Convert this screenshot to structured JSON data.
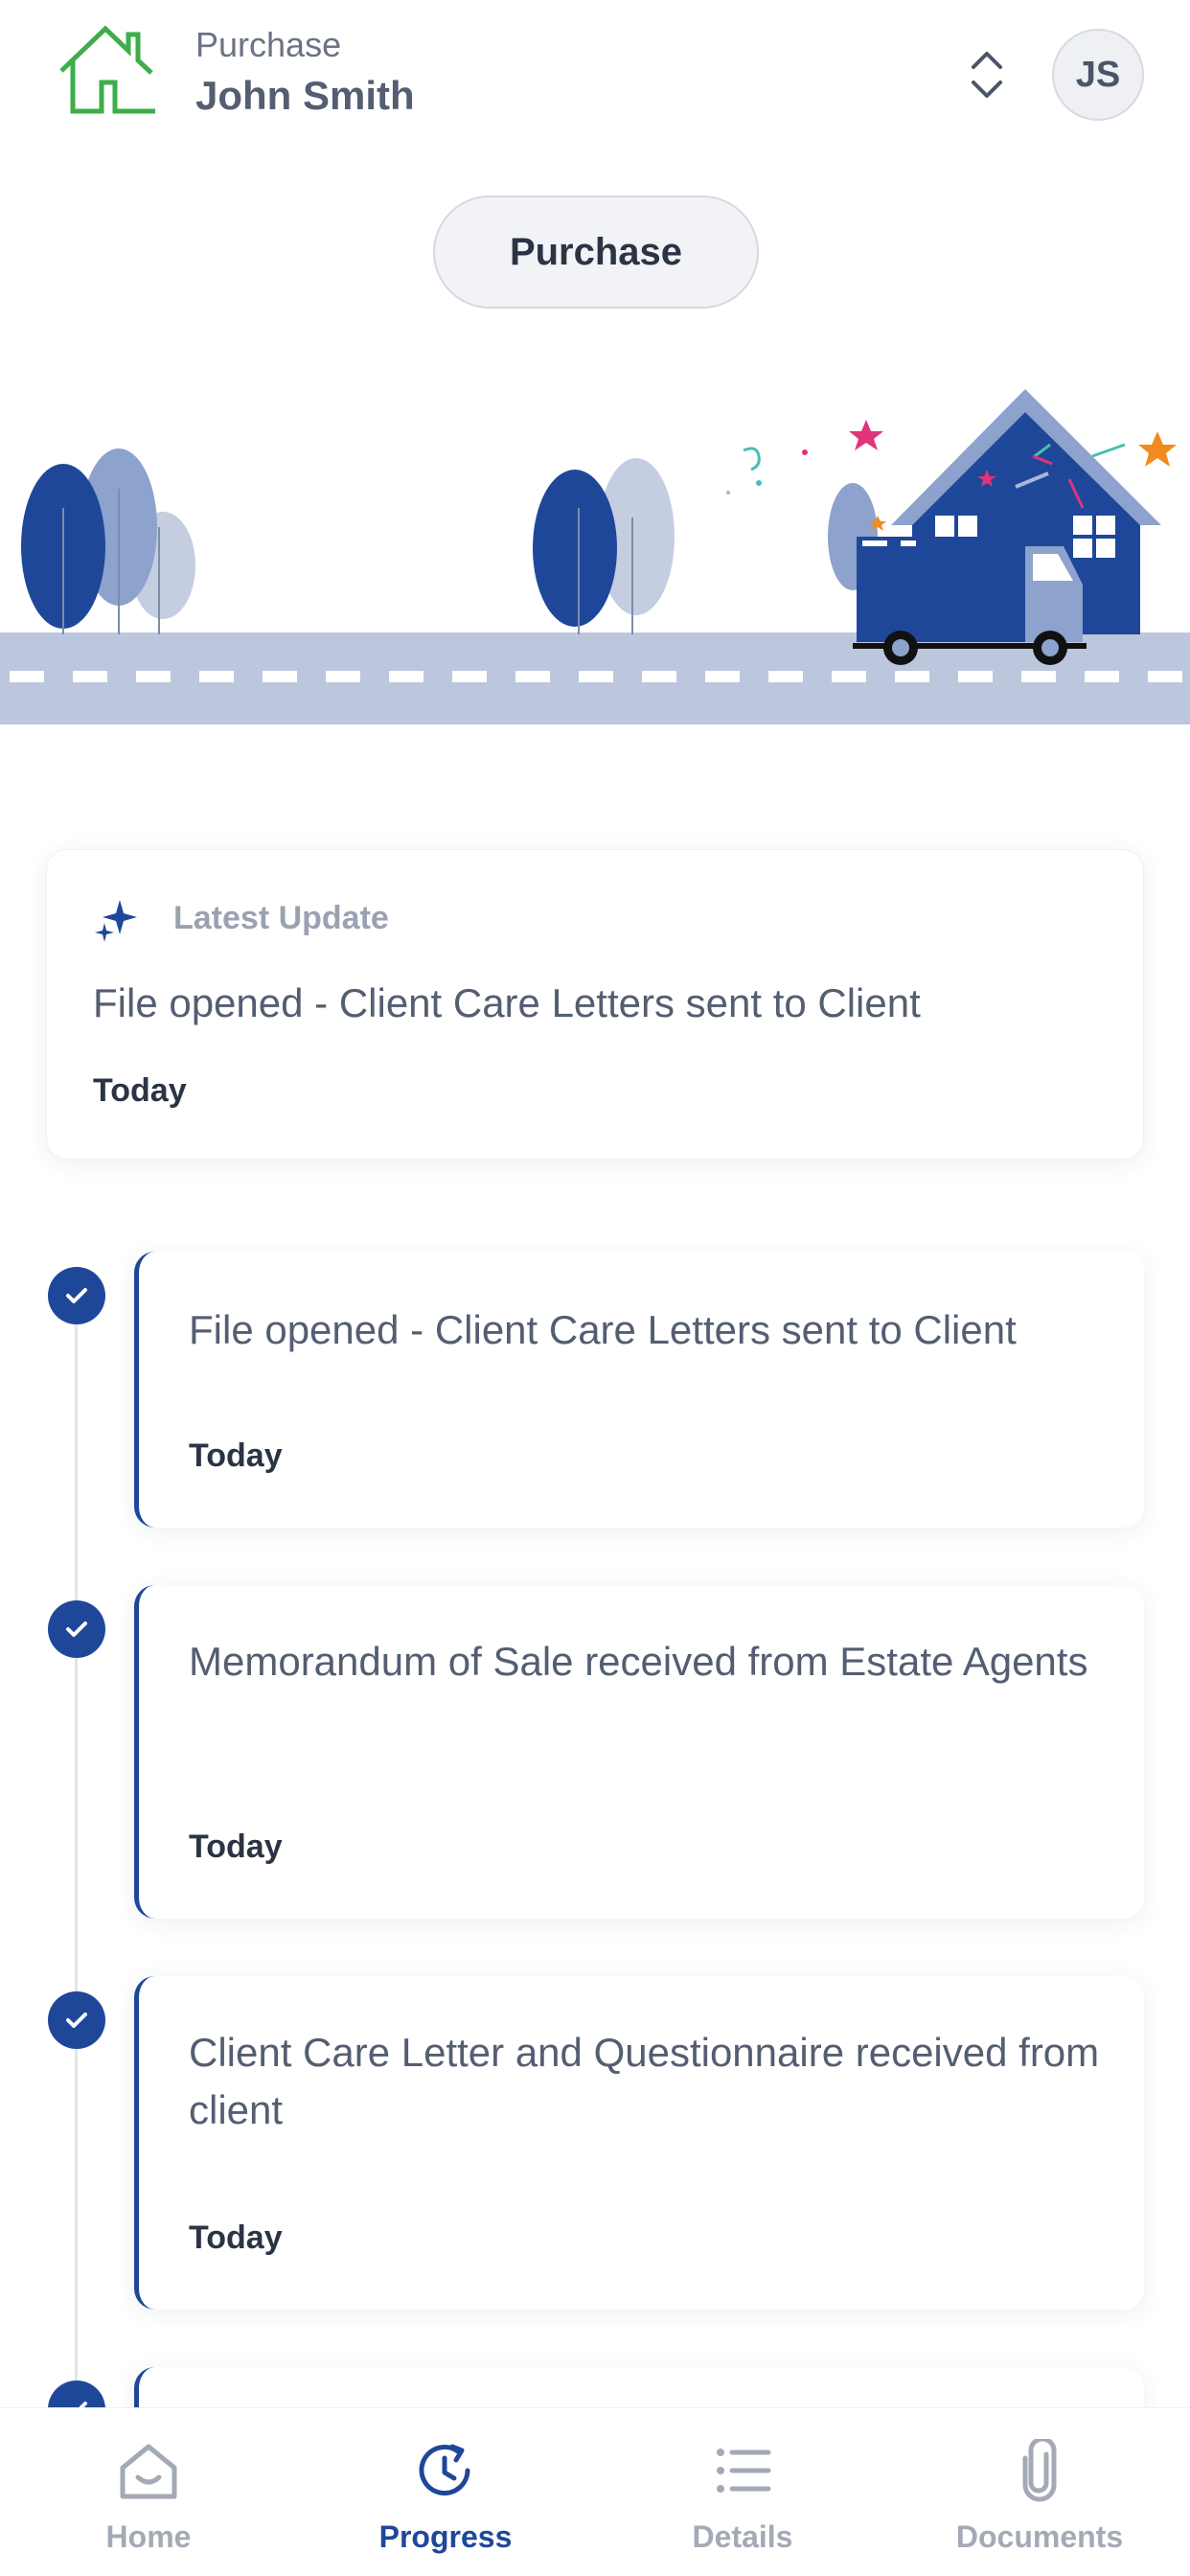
{
  "header": {
    "subtitle": "Purchase",
    "client_name": "John Smith",
    "avatar_initials": "JS"
  },
  "matter_type_button": "Purchase",
  "latest_update": {
    "label": "Latest Update",
    "text": "File opened - Client Care Letters sent to Client",
    "date": "Today"
  },
  "timeline": [
    {
      "title": "File opened - Client Care Letters sent to Client",
      "date": "Today"
    },
    {
      "title": "Memorandum of Sale received from Estate Agents",
      "date": "Today"
    },
    {
      "title": "Client Care Letter and Questionnaire received from client",
      "date": "Today"
    }
  ],
  "bottom_nav": [
    {
      "label": "Home",
      "icon": "home-icon",
      "active": false
    },
    {
      "label": "Progress",
      "icon": "progress-clock-icon",
      "active": true
    },
    {
      "label": "Details",
      "icon": "list-icon",
      "active": false
    },
    {
      "label": "Documents",
      "icon": "paperclip-icon",
      "active": false
    }
  ],
  "colors": {
    "brand_blue": "#1f4799",
    "logo_green": "#3dae4a",
    "road": "#bcc7dd",
    "light_blue": "#8da2cc"
  }
}
